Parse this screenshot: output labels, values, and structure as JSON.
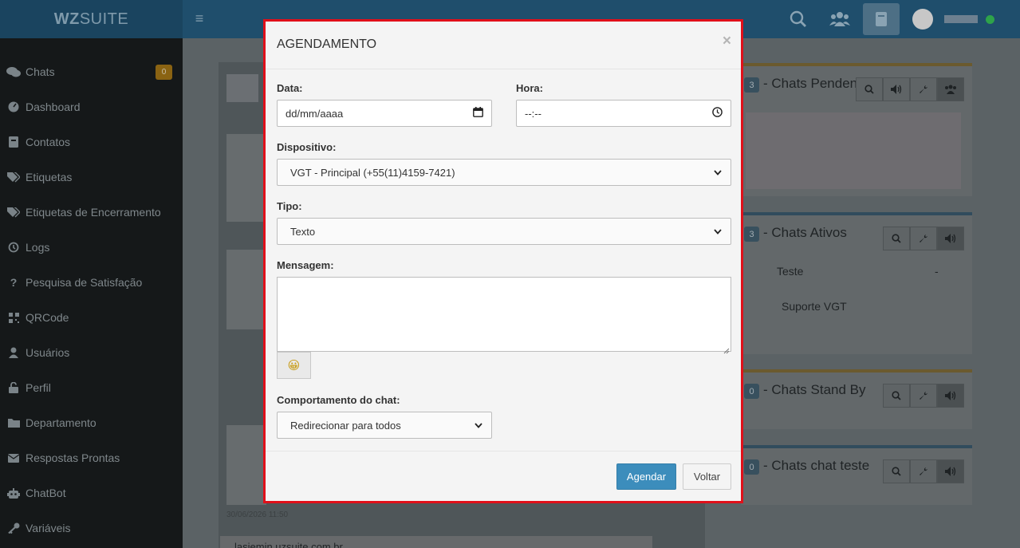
{
  "app": {
    "brand_bold": "WZ",
    "brand_rest": "SUITE"
  },
  "sidebar": {
    "items": [
      {
        "label": "Chats",
        "icon": "comments-icon",
        "badge": "0"
      },
      {
        "label": "Dashboard",
        "icon": "dashboard-icon"
      },
      {
        "label": "Contatos",
        "icon": "address-book-icon"
      },
      {
        "label": "Etiquetas",
        "icon": "tags-icon"
      },
      {
        "label": "Etiquetas de Encerramento",
        "icon": "tags-icon"
      },
      {
        "label": "Logs",
        "icon": "history-icon"
      },
      {
        "label": "Pesquisa de Satisfação",
        "icon": "question-icon"
      },
      {
        "label": "QRCode",
        "icon": "qrcode-icon"
      },
      {
        "label": "Usuários",
        "icon": "user-icon"
      },
      {
        "label": "Perfil",
        "icon": "unlock-icon"
      },
      {
        "label": "Departamento",
        "icon": "folder-icon"
      },
      {
        "label": "Respostas Prontas",
        "icon": "envelope-icon"
      },
      {
        "label": "ChatBot",
        "icon": "robot-icon"
      },
      {
        "label": "Variáveis",
        "icon": "key-icon"
      }
    ]
  },
  "background": {
    "panels": [
      {
        "count": "3",
        "title": "- Chats Penden"
      },
      {
        "count": "3",
        "title": "- Chats Ativos",
        "rows": [
          {
            "name": "Teste",
            "suffix": "-"
          },
          {
            "name": "Suporte VGT"
          }
        ]
      },
      {
        "count": "0",
        "title": "- Chats Stand By"
      },
      {
        "count": "0",
        "title": "- Chats chat teste"
      }
    ],
    "timestamp": "30/06/2026 11:50",
    "bottom_card_text": "lasiemin uzsuite.com.br"
  },
  "modal": {
    "title": "AGENDAMENTO",
    "close": "×",
    "date_label": "Data:",
    "date_placeholder": "dd/mm/aaaa",
    "time_label": "Hora:",
    "time_placeholder": "--:--",
    "device_label": "Dispositivo:",
    "device_value": "VGT - Principal (+55(11)4159-7421)",
    "type_label": "Tipo:",
    "type_value": "Texto",
    "message_label": "Mensagem:",
    "message_value": "",
    "emoji": "😀",
    "behavior_label": "Comportamento do chat:",
    "behavior_value": "Redirecionar para todos",
    "submit_label": "Agendar",
    "back_label": "Voltar"
  },
  "colors": {
    "highlight_border": "#e0101a",
    "primary": "#3c8dbc",
    "topbar": "#1f4e6c",
    "sidebar": "#151819"
  }
}
